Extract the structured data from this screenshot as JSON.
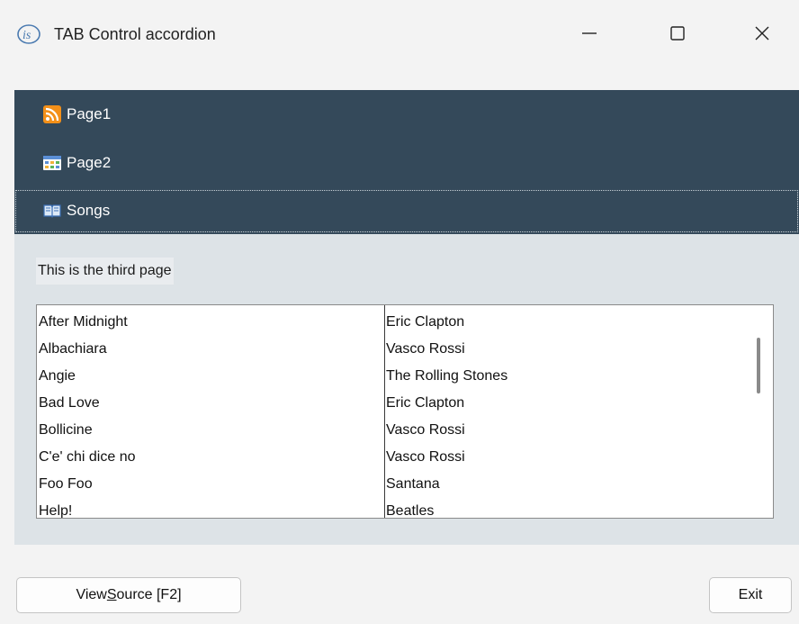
{
  "window": {
    "title": "TAB Control accordion",
    "app_icon_text": "is",
    "icons": [
      "is-logo-icon",
      "minimize-icon",
      "maximize-icon",
      "close-icon"
    ]
  },
  "accordion": {
    "colors": {
      "header_bg": "#34495a",
      "panel_bg": "#dde3e7"
    },
    "items": [
      {
        "label": "Page1",
        "icon": "rss-icon"
      },
      {
        "label": "Page2",
        "icon": "table-icon"
      },
      {
        "label": "Songs",
        "icon": "book-icon",
        "selected": true
      }
    ]
  },
  "content": {
    "label": "This is the third page",
    "songs": [
      {
        "title": "After Midnight",
        "artist": "Eric Clapton"
      },
      {
        "title": "Albachiara",
        "artist": "Vasco Rossi"
      },
      {
        "title": "Angie",
        "artist": "The Rolling Stones"
      },
      {
        "title": "Bad Love",
        "artist": "Eric Clapton"
      },
      {
        "title": "Bollicine",
        "artist": "Vasco Rossi"
      },
      {
        "title": "C'e' chi dice no",
        "artist": "Vasco Rossi"
      },
      {
        "title": "Foo Foo",
        "artist": "Santana"
      },
      {
        "title": "Help!",
        "artist": "Beatles"
      }
    ]
  },
  "buttons": {
    "view_source_pre": "View ",
    "view_source_hot": "S",
    "view_source_post": "ource [F2]",
    "exit": "Exit"
  }
}
